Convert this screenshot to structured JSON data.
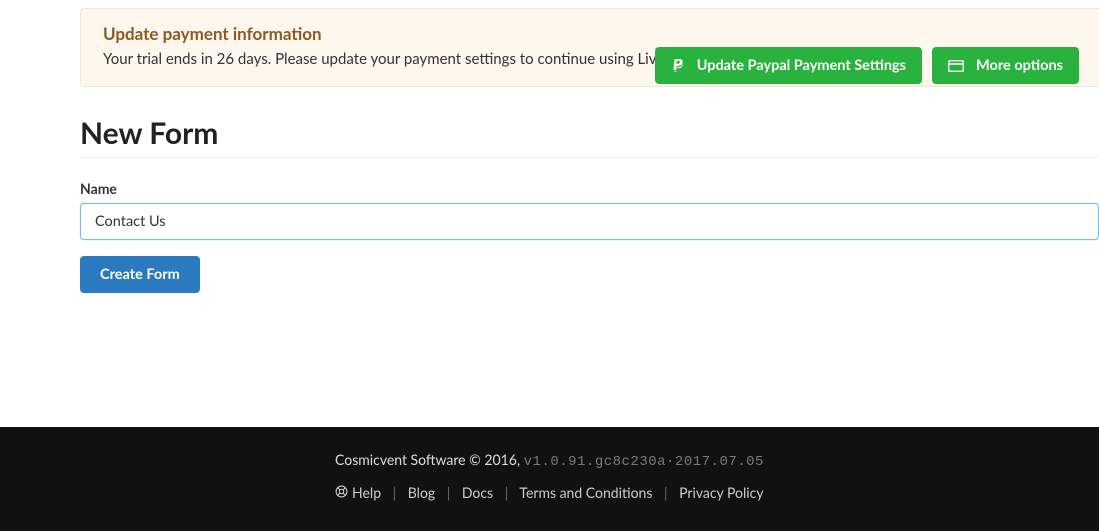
{
  "alert": {
    "title": "Update payment information",
    "text": "Your trial ends in 26 days. Please update your payment settings to continue using LiveForm",
    "updateButton": "Update Paypal Payment Settings",
    "moreOptions": "More options"
  },
  "page": {
    "title": "New Form"
  },
  "form": {
    "nameLabel": "Name",
    "nameValue": "Contact Us",
    "submit": "Create Form"
  },
  "footer": {
    "copyright": "Cosmicvent Software © 2016,",
    "version": "v1.0.91.gc8c230a·2017.07.05",
    "help": "Help",
    "blog": "Blog",
    "docs": "Docs",
    "terms": "Terms and Conditions",
    "privacy": "Privacy Policy"
  }
}
